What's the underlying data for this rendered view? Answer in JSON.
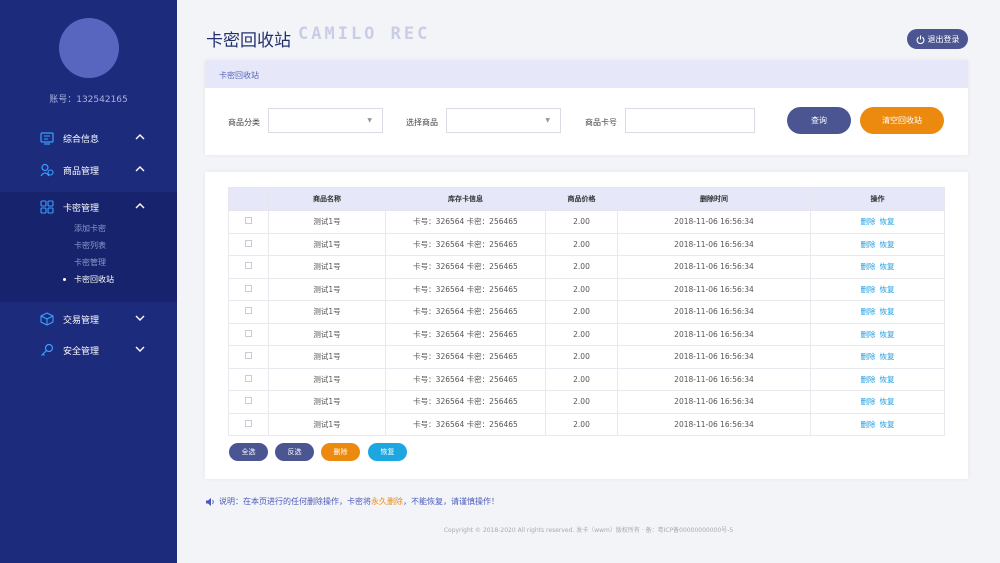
{
  "sidebar": {
    "account": "账号：132542165",
    "items": [
      {
        "label": "综合信息",
        "icon": "info-icon",
        "chevron": "up"
      },
      {
        "label": "商品管理",
        "icon": "users-icon",
        "chevron": "up"
      },
      {
        "label": "卡密管理",
        "icon": "grid-icon",
        "chevron": "up"
      },
      {
        "label": "交易管理",
        "icon": "box-icon",
        "chevron": "down"
      },
      {
        "label": "安全管理",
        "icon": "key-icon",
        "chevron": "down"
      }
    ],
    "submenu": [
      {
        "label": "添加卡密",
        "active": false
      },
      {
        "label": "卡密列表",
        "active": false
      },
      {
        "label": "卡密管理",
        "active": false
      },
      {
        "label": "卡密回收站",
        "active": true
      }
    ]
  },
  "header": {
    "title": "卡密回收站",
    "deco": "CAMILO REC",
    "logout": "退出登录"
  },
  "filter": {
    "heading": "卡密回收站",
    "category_label": "商品分类",
    "category_value": "",
    "product_label": "选择商品",
    "product_value": "",
    "card_label": "商品卡号",
    "card_value": "",
    "query_button": "查询",
    "clear_button": "清空回收站"
  },
  "table": {
    "columns": [
      "",
      "商品名称",
      "库存卡信息",
      "商品价格",
      "删除时间",
      "操作"
    ],
    "rows": [
      {
        "name": "测试1号",
        "info": "卡号：326564  卡密：256465",
        "price": "2.00",
        "time": "2018-11-06  16:56:34"
      },
      {
        "name": "测试1号",
        "info": "卡号：326564  卡密：256465",
        "price": "2.00",
        "time": "2018-11-06  16:56:34"
      },
      {
        "name": "测试1号",
        "info": "卡号：326564  卡密：256465",
        "price": "2.00",
        "time": "2018-11-06  16:56:34"
      },
      {
        "name": "测试1号",
        "info": "卡号：326564  卡密：256465",
        "price": "2.00",
        "time": "2018-11-06  16:56:34"
      },
      {
        "name": "测试1号",
        "info": "卡号：326564  卡密：256465",
        "price": "2.00",
        "time": "2018-11-06  16:56:34"
      },
      {
        "name": "测试1号",
        "info": "卡号：326564  卡密：256465",
        "price": "2.00",
        "time": "2018-11-06  16:56:34"
      },
      {
        "name": "测试1号",
        "info": "卡号：326564  卡密：256465",
        "price": "2.00",
        "time": "2018-11-06  16:56:34"
      },
      {
        "name": "测试1号",
        "info": "卡号：326564  卡密：256465",
        "price": "2.00",
        "time": "2018-11-06  16:56:34"
      },
      {
        "name": "测试1号",
        "info": "卡号：326564  卡密：256465",
        "price": "2.00",
        "time": "2018-11-06  16:56:34"
      },
      {
        "name": "测试1号",
        "info": "卡号：326564  卡密：256465",
        "price": "2.00",
        "time": "2018-11-06  16:56:34"
      }
    ],
    "action_delete": "删除",
    "action_restore": "恢复"
  },
  "bulk": {
    "select_all": "全选",
    "invert": "反选",
    "delete": "删除",
    "restore": "恢复"
  },
  "note": {
    "prefix": "说明：在本页进行的任何删除操作，卡密将",
    "warn": "永久删除",
    "suffix": "，不能恢复，请谨慎操作！"
  },
  "footer": "Copyright © 2018-2020 All rights reserved. 发卡（wwm）版权所有 · 备：粤ICP备00000000000号-5",
  "colors": {
    "sidebar": "#1d2b7d",
    "primary": "#4a5592",
    "accent": "#ec8a0f",
    "restore": "#1ca7e0",
    "link": "#1c9ce0"
  }
}
